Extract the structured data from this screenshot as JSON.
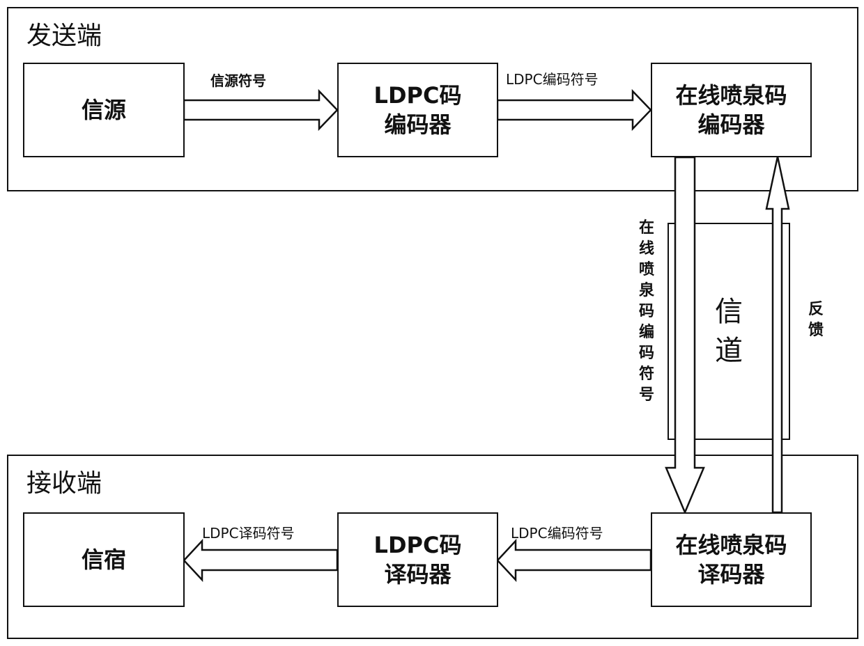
{
  "sender": {
    "title": "发送端",
    "source": "信源",
    "ldpc_encoder": [
      "LDPC码",
      "编码器"
    ],
    "fountain_encoder": [
      "在线喷泉码",
      "编码器"
    ],
    "arrow_source_symbols": "信源符号",
    "arrow_ldpc_encoded": "LDPC编码符号"
  },
  "channel": {
    "label": [
      "信",
      "道"
    ],
    "down_label": "在线喷泉码编码符号",
    "up_label": "反馈"
  },
  "receiver": {
    "title": "接收端",
    "sink": "信宿",
    "ldpc_decoder": [
      "LDPC码",
      "译码器"
    ],
    "fountain_decoder": [
      "在线喷泉码",
      "译码器"
    ],
    "arrow_ldpc_decoded": "LDPC译码符号",
    "arrow_ldpc_encoded": "LDPC编码符号"
  }
}
